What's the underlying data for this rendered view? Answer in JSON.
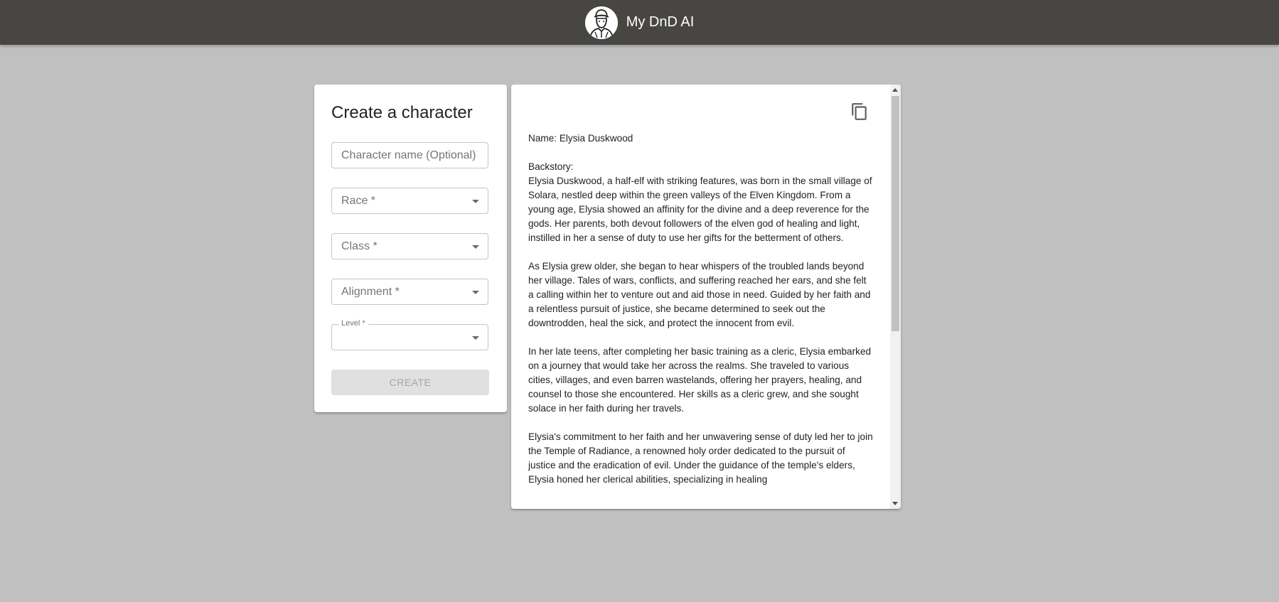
{
  "app": {
    "title": "My DnD AI",
    "logo_icon": "adventurer-avatar-icon"
  },
  "form": {
    "title": "Create a character",
    "name_placeholder": "Character name (Optional)",
    "race_label": "Race *",
    "class_label": "Class *",
    "alignment_label": "Alignment *",
    "level_label": "Level *",
    "level_value": "",
    "create_label": "CREATE"
  },
  "output": {
    "copy_icon": "copy-icon",
    "text": "Name: Elysia Duskwood\n\nBackstory:\nElysia Duskwood, a half-elf with striking features, was born in the small village of Solara, nestled deep within the green valleys of the Elven Kingdom. From a young age, Elysia showed an affinity for the divine and a deep reverence for the gods. Her parents, both devout followers of the elven god of healing and light, instilled in her a sense of duty to use her gifts for the betterment of others.\n\nAs Elysia grew older, she began to hear whispers of the troubled lands beyond her village. Tales of wars, conflicts, and suffering reached her ears, and she felt a calling within her to venture out and aid those in need. Guided by her faith and a relentless pursuit of justice, she became determined to seek out the downtrodden, heal the sick, and protect the innocent from evil.\n\nIn her late teens, after completing her basic training as a cleric, Elysia embarked on a journey that would take her across the realms. She traveled to various cities, villages, and even barren wastelands, offering her prayers, healing, and counsel to those she encountered. Her skills as a cleric grew, and she sought solace in her faith during her travels.\n\nElysia's commitment to her faith and her unwavering sense of duty led her to join the Temple of Radiance, a renowned holy order dedicated to the pursuit of justice and the eradication of evil. Under the guidance of the temple's elders, Elysia honed her clerical abilities, specializing in healing"
  },
  "colors": {
    "appbar": "#484643",
    "background": "#c0c0c0",
    "card": "#ffffff"
  }
}
